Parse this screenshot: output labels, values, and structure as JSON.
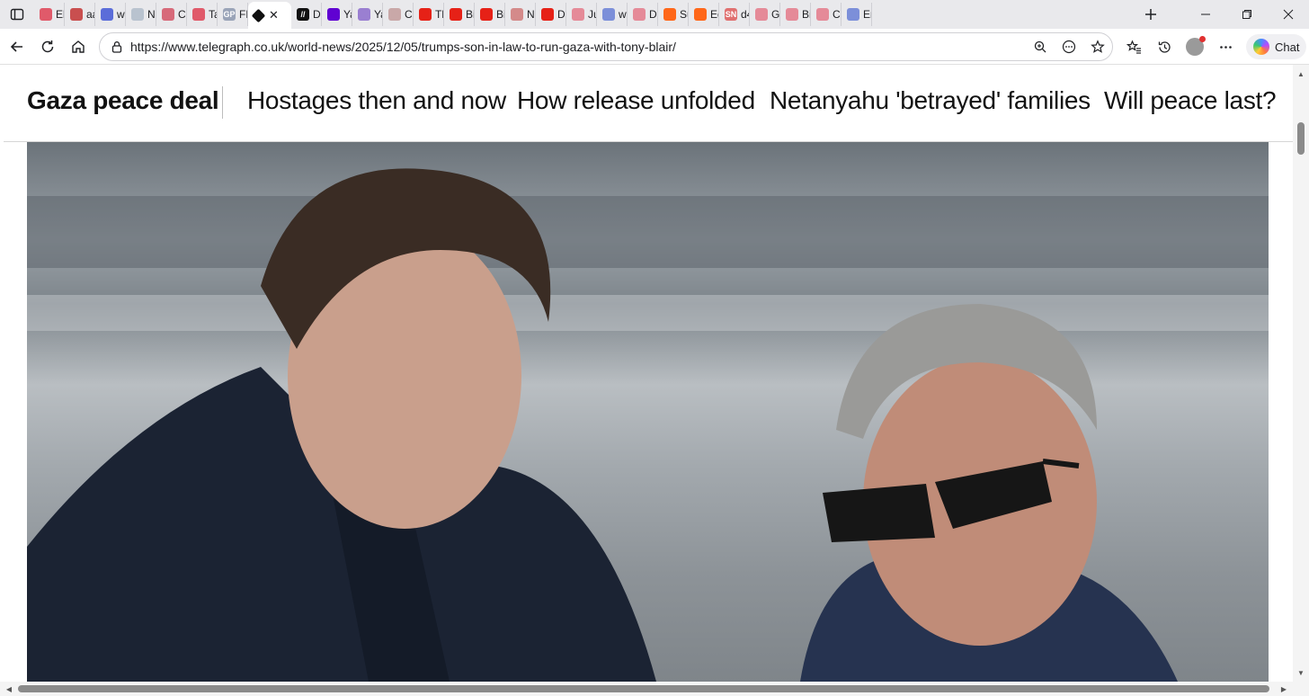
{
  "browser": {
    "tabs": [
      {
        "title": "Elt",
        "icon": "youtube-icon",
        "color": "#e05a6a"
      },
      {
        "title": "aa",
        "icon": "feather-icon",
        "color": "#c94f4f"
      },
      {
        "title": "we",
        "icon": "search-icon",
        "color": "#5b6dd9"
      },
      {
        "title": "Ni",
        "icon": "globe-icon",
        "color": "#b9c3cf"
      },
      {
        "title": "Ca",
        "icon": "pin-icon",
        "color": "#d76a7a"
      },
      {
        "title": "Tal",
        "icon": "youtube-icon",
        "color": "#e05a6a"
      },
      {
        "title": "FL",
        "icon": "gp-icon",
        "color": "#9aa4b8"
      },
      {
        "title": "",
        "icon": "diamond-icon",
        "color": "#111111",
        "active": true
      },
      {
        "title": "DF",
        "icon": "dm-icon",
        "color": "#111111"
      },
      {
        "title": "Ya",
        "icon": "yahoo-icon",
        "color": "#6001d2"
      },
      {
        "title": "Ya",
        "icon": "quill-icon",
        "color": "#9a7fd1"
      },
      {
        "title": "Cr",
        "icon": "wave-icon",
        "color": "#c9a8a8"
      },
      {
        "title": "Th",
        "icon": "youtube-icon",
        "color": "#e62117"
      },
      {
        "title": "Bil",
        "icon": "youtube-icon",
        "color": "#e62117"
      },
      {
        "title": "Bil",
        "icon": "youtube-icon",
        "color": "#e62117"
      },
      {
        "title": "Ni",
        "icon": "leaf-icon",
        "color": "#d48a8a"
      },
      {
        "title": "Dr",
        "icon": "youtube-icon",
        "color": "#e62117"
      },
      {
        "title": "Jus",
        "icon": "youtube-icon",
        "color": "#e58a98"
      },
      {
        "title": "wv",
        "icon": "search-icon",
        "color": "#7c8fd9"
      },
      {
        "title": "De",
        "icon": "youtube-icon",
        "color": "#e58a98"
      },
      {
        "title": "Su",
        "icon": "substack-icon",
        "color": "#ff6719"
      },
      {
        "title": "Ed",
        "icon": "substack-icon",
        "color": "#ff6719"
      },
      {
        "title": "d4",
        "icon": "sn-icon",
        "color": "#e07070"
      },
      {
        "title": "Gu",
        "icon": "youtube-icon",
        "color": "#e58a98"
      },
      {
        "title": "Bil",
        "icon": "youtube-icon",
        "color": "#e58a98"
      },
      {
        "title": "Ca",
        "icon": "youtube-icon",
        "color": "#e58a98"
      },
      {
        "title": "Ero",
        "icon": "search-icon",
        "color": "#7c8fd9"
      }
    ],
    "url": "https://www.telegraph.co.uk/world-news/2025/12/05/trumps-son-in-law-to-run-gaza-with-tony-blair/",
    "chat_label": "Chat",
    "fav_labels": {
      "gp": "GP",
      "sn": "SN",
      "dm": "//"
    }
  },
  "page": {
    "topic_title": "Gaza peace deal",
    "topic_links": [
      {
        "label": "Hostages then and now"
      },
      {
        "label": "How release unfolded"
      },
      {
        "label": "Netanyahu 'betrayed' families"
      },
      {
        "label": "Will peace last?"
      }
    ],
    "hero": {
      "icon": "photo-icon"
    }
  }
}
